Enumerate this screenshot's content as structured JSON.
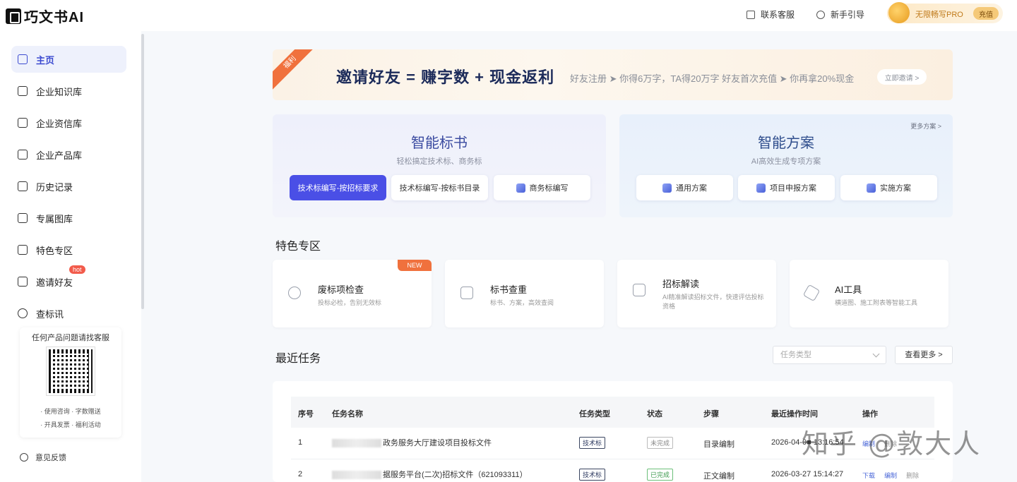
{
  "header": {
    "logo_text": "巧文书AI",
    "links": [
      "联系客服",
      "新手引导"
    ],
    "pro_text": "无限畅写PRO",
    "pro_button": "充值"
  },
  "sidebar": {
    "items": [
      {
        "label": "主页",
        "icon": "home-icon",
        "active": true
      },
      {
        "label": "企业知识库",
        "icon": "book-icon"
      },
      {
        "label": "企业资信库",
        "icon": "shield-icon"
      },
      {
        "label": "企业产品库",
        "icon": "box-icon"
      },
      {
        "label": "历史记录",
        "icon": "document-icon"
      },
      {
        "label": "专属图库",
        "icon": "camera-icon"
      },
      {
        "label": "特色专区",
        "icon": "star-icon"
      },
      {
        "label": "邀请好友",
        "icon": "gift-icon",
        "badge": "hot"
      },
      {
        "label": "查标讯",
        "icon": "target-icon"
      }
    ],
    "qr_card": {
      "title": "任何产品问题请找客服",
      "lines": [
        "· 使用咨询 · 字数赠送",
        "· 开具发票 · 福利活动"
      ]
    },
    "feedback": "意见反馈"
  },
  "banner": {
    "ribbon": "福利",
    "title": "邀请好友 = 赚字数 + 现金返利",
    "subtitle": "好友注册 ➤ 你得6万字，TA得20万字    好友首次充值 ➤ 你再拿20%现金",
    "button": "立即邀请 >"
  },
  "panels": {
    "left": {
      "title": "智能标书",
      "subtitle": "轻松搞定技术标、商务标",
      "buttons": [
        "技术标编写-按招标要求",
        "技术标编写-按标书目录",
        "商务标编写"
      ]
    },
    "right": {
      "more": "更多方案 >",
      "title": "智能方案",
      "subtitle": "AI高效生成专项方案",
      "buttons": [
        "通用方案",
        "项目申报方案",
        "实施方案"
      ]
    }
  },
  "features": {
    "title": "特色专区",
    "cards": [
      {
        "title": "废标项检查",
        "desc": "投标必检，告别无效标",
        "tag": "NEW"
      },
      {
        "title": "标书查重",
        "desc": "标书、方案，高效查阅"
      },
      {
        "title": "招标解读",
        "desc": "AI精准解读招标文件，快速评估投标资格"
      },
      {
        "title": "AI工具",
        "desc": "横道图、施工附表等智能工具"
      }
    ]
  },
  "tasks": {
    "title": "最近任务",
    "select_placeholder": "任务类型",
    "view_more": "查看更多 >",
    "columns": [
      "序号",
      "任务名称",
      "任务类型",
      "状态",
      "步骤",
      "最近操作时间",
      "操作"
    ],
    "rows": [
      {
        "no": "1",
        "name": "政务服务大厅建设项目投标文件",
        "type": "技术标",
        "status": "未完成",
        "step": "目录编制",
        "time": "2026-04-0■ 13:16:54",
        "actions": [
          "编制",
          "删除"
        ]
      },
      {
        "no": "2",
        "name": "据服务平台(二次)招标文件（621093311）",
        "type": "技术标",
        "status": "已完成",
        "step": "正文编制",
        "time": "2026-03-27 15:14:27",
        "actions": [
          "下载",
          "编制",
          "删除"
        ]
      }
    ]
  },
  "watermark": "知乎 @敦大人"
}
